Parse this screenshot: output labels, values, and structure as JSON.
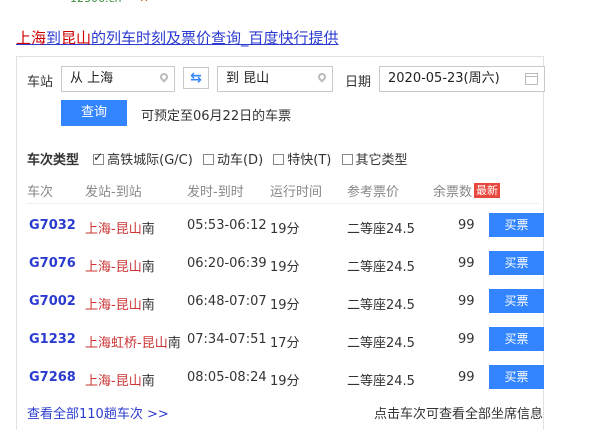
{
  "title": {
    "from": "上海",
    "to_word": "到",
    "to": "昆山",
    "rest": "的列车时刻及票价查询_百度快行提供"
  },
  "search": {
    "station_label": "车站",
    "from_value": "从 上海",
    "to_value": "到 昆山",
    "date_label": "日期",
    "date_value": "2020-05-23(周六)",
    "query_button": "查询",
    "presale_note": "可预定至06月22日的车票"
  },
  "filters": {
    "label": "车次类型",
    "options": [
      {
        "label": "高铁城际(G/C)",
        "checked": true
      },
      {
        "label": "动车(D)",
        "checked": false
      },
      {
        "label": "特快(T)",
        "checked": false
      },
      {
        "label": "其它类型",
        "checked": false
      }
    ]
  },
  "columns": {
    "train": "车次",
    "route": "发站-到站",
    "time": "发时-到时",
    "duration": "运行时间",
    "price": "参考票价",
    "remaining": "余票数",
    "new_badge": "最新"
  },
  "rows": [
    {
      "train": "G7032",
      "from": "上海",
      "to": "昆山",
      "to_suffix": "南",
      "time": "05:53-06:12",
      "duration": "19分",
      "price": "二等座24.5",
      "remaining": "99",
      "buy": "买票"
    },
    {
      "train": "G7076",
      "from": "上海",
      "to": "昆山",
      "to_suffix": "南",
      "time": "06:20-06:39",
      "duration": "19分",
      "price": "二等座24.5",
      "remaining": "99",
      "buy": "买票"
    },
    {
      "train": "G7002",
      "from": "上海",
      "to": "昆山",
      "to_suffix": "南",
      "time": "06:48-07:07",
      "duration": "19分",
      "price": "二等座24.5",
      "remaining": "99",
      "buy": "买票"
    },
    {
      "train": "G1232",
      "from": "上海虹桥",
      "to": "昆山",
      "to_suffix": "南",
      "time": "07:34-07:51",
      "duration": "17分",
      "price": "二等座24.5",
      "remaining": "99",
      "buy": "买票"
    },
    {
      "train": "G7268",
      "from": "上海",
      "to": "昆山",
      "to_suffix": "南",
      "time": "08:05-08:24",
      "duration": "19分",
      "price": "二等座24.5",
      "remaining": "99",
      "buy": "买票"
    }
  ],
  "footer": {
    "view_all": "查看全部110趟车次 >>",
    "hint": "点击车次可查看全部坐席信息"
  },
  "colors": {
    "accent": "#3385ff",
    "link": "#2b3bd0",
    "route": "#cc3333",
    "badge": "#e8473d"
  }
}
